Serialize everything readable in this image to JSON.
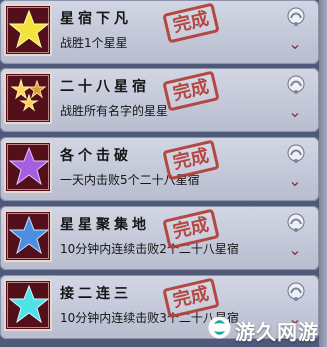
{
  "achievements": [
    {
      "title": "星宿下凡",
      "description": "战胜1个星星",
      "stamp": "完成",
      "star_color": "#f1e14a",
      "icon": "yellow-star-icon"
    },
    {
      "title": "二十八星宿",
      "description": "战胜所有名字的星星",
      "stamp": "完成",
      "star_color": "#d9a84a",
      "icon": "gold-stars-icon"
    },
    {
      "title": "各个击破",
      "description": "一天内击败5个二十八星宿",
      "stamp": "完成",
      "star_color": "#9a5ad6",
      "icon": "purple-star-icon"
    },
    {
      "title": "星星聚集地",
      "description": "10分钟内连续击败2个二十八星宿",
      "stamp": "完成",
      "star_color": "#4f8ad9",
      "icon": "blue-star-icon"
    },
    {
      "title": "接二连三",
      "description": "10分钟内连续击败3个二十八星宿",
      "stamp": "完成",
      "star_color": "#4ce0e4",
      "icon": "cyan-star-icon"
    }
  ],
  "watermark": {
    "text": "游久网游"
  }
}
